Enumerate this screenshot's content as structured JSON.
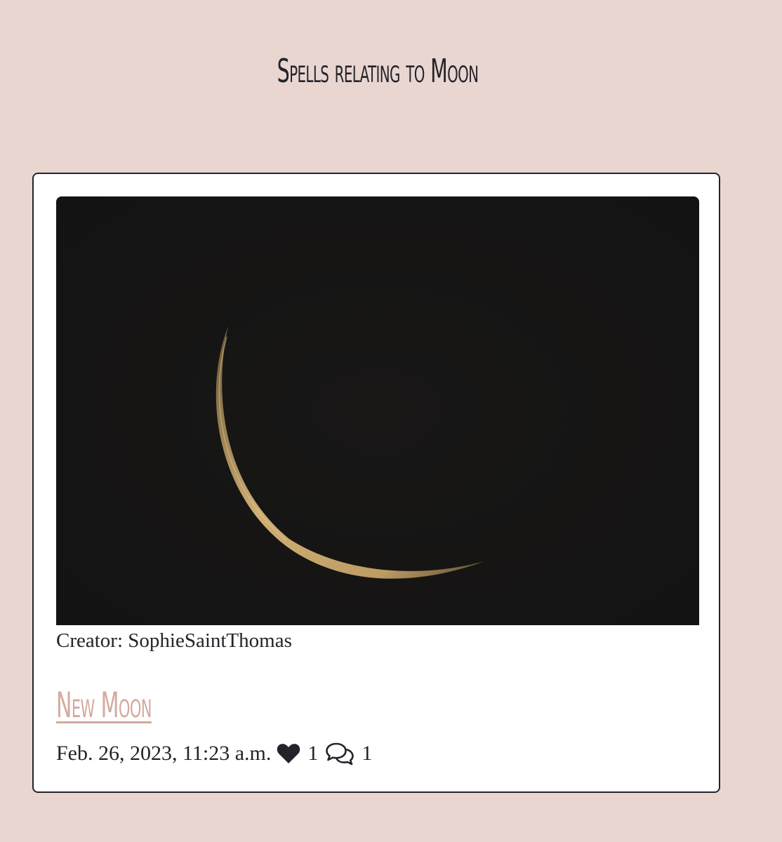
{
  "page": {
    "title": "Spells relating to Moon"
  },
  "card": {
    "image_description_icon": "moon-photo",
    "creator_label": "Creator: SophieSaintThomas",
    "spell_title": "New Moon",
    "date": "Feb. 26, 2023, 11:23 a.m.",
    "likes": "1",
    "comments": "1",
    "like_icon": "heart-icon",
    "comment_icon": "comments-icon"
  },
  "colors": {
    "background": "#e9d6d1",
    "card": "#ffffff",
    "text": "#24232a",
    "link": "#d3a99e",
    "image_bg": "#161515",
    "moon": "#c9a86a"
  }
}
